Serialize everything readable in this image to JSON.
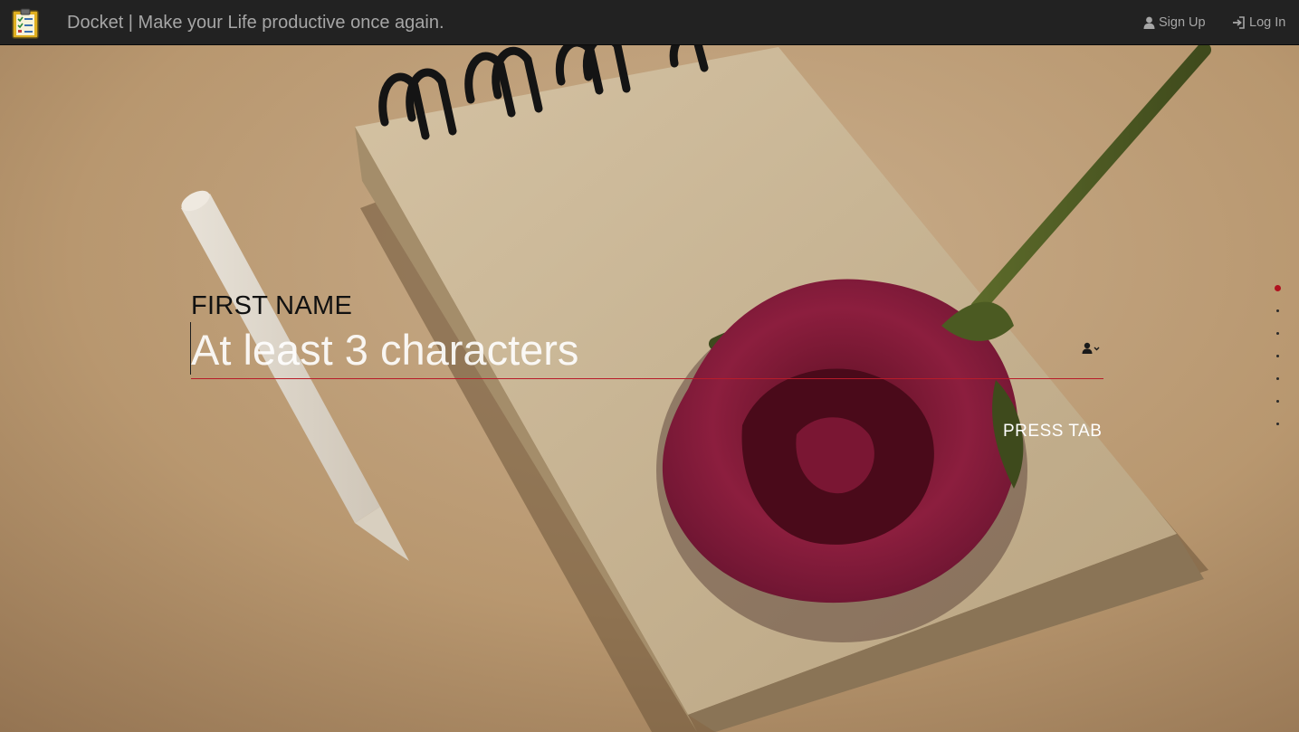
{
  "navbar": {
    "title": "Docket | Make your Life productive once again.",
    "logo_icon": "clipboard-checklist-icon",
    "signup_label": "Sign Up",
    "signup_icon": "user-icon",
    "login_label": "Log In",
    "login_icon": "sign-in-icon"
  },
  "form": {
    "field_label": "FIRST NAME",
    "input_value": "",
    "input_placeholder": "At least 3 characters",
    "field_icon": "user-dropdown-icon",
    "hint": "PRESS TAB"
  },
  "steps": {
    "total": 7,
    "active_index": 0
  },
  "colors": {
    "navbar_bg": "#222222",
    "navbar_text": "#a6a6a6",
    "accent_red": "#b81c2a",
    "active_dot": "#b0121f"
  }
}
